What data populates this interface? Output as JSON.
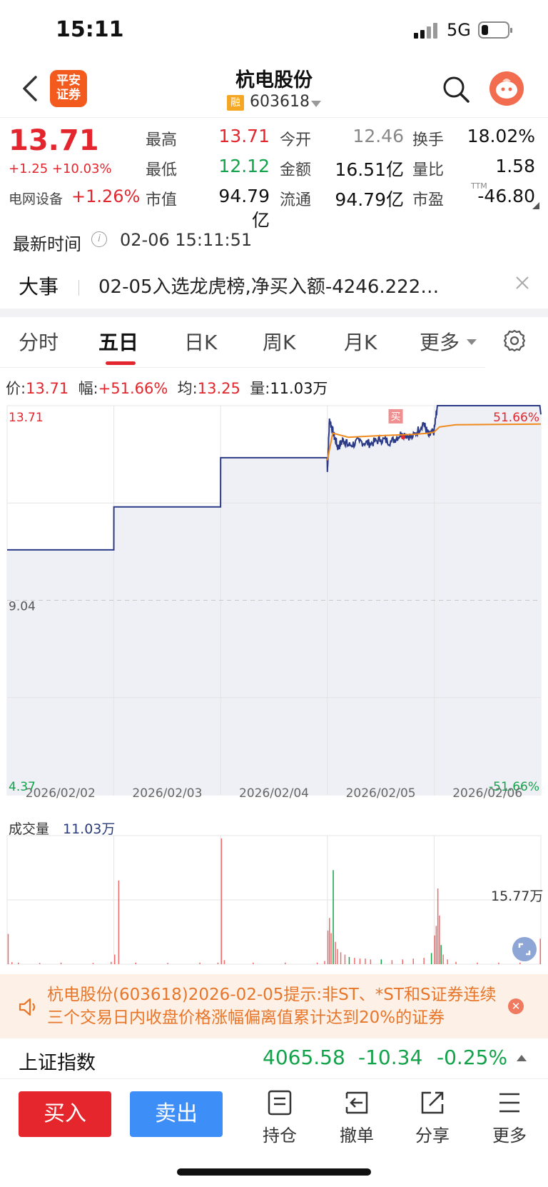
{
  "status": {
    "time": "15:11",
    "network": "5G"
  },
  "header": {
    "logo_line1": "平安",
    "logo_line2": "证券",
    "title": "杭电股份",
    "tag": "融",
    "code": "603618"
  },
  "quote": {
    "price": "13.71",
    "change": "+1.25  +10.03%",
    "sector_name": "电网设备",
    "sector_change": "+1.26%",
    "rows": [
      [
        {
          "l": "最高",
          "v": "13.71",
          "c": "red"
        },
        {
          "l": "今开",
          "v": "12.46",
          "c": "grey"
        },
        {
          "l": "换手",
          "v": "18.02%",
          "c": "blk"
        }
      ],
      [
        {
          "l": "最低",
          "v": "12.12",
          "c": "green"
        },
        {
          "l": "金额",
          "v": "16.51亿",
          "c": "blk"
        },
        {
          "l": "量比",
          "v": "1.58",
          "c": "blk"
        }
      ],
      [
        {
          "l": "市值",
          "v": "94.79亿",
          "c": "blk"
        },
        {
          "l": "流通",
          "v": "94.79亿",
          "c": "blk"
        },
        {
          "l": "市盈",
          "v": "-46.80",
          "c": "blk"
        }
      ]
    ],
    "ttm": "TTM"
  },
  "latest": {
    "label": "最新时间",
    "value": "02-06 15:11:51"
  },
  "event": {
    "label": "大事",
    "text": "02-05入选龙虎榜,净买入额-4246.222…"
  },
  "tabs": [
    "分时",
    "五日",
    "日K",
    "周K",
    "月K",
    "更多"
  ],
  "active_tab": "五日",
  "stats": {
    "price_label": "价:",
    "price": "13.71",
    "range_label": "幅:",
    "range": "+51.66%",
    "avg_label": "均:",
    "avg": "13.25",
    "vol_label": "量:",
    "vol": "11.03万"
  },
  "chart_data": {
    "type": "line",
    "ylim": [
      4.37,
      13.71
    ],
    "y_top_label": "13.71",
    "y_mid_label": "9.04",
    "y_bottom_label": "4.37",
    "pct_top": "51.66%",
    "pct_bottom": "-51.66%",
    "x_labels": [
      "2026/02/02",
      "2026/02/03",
      "2026/02/04",
      "2026/02/05",
      "2026/02/06"
    ],
    "buy_marker": "买",
    "series": [
      {
        "values": [
          [
            0.0,
            10.25
          ],
          [
            0.999,
            10.25
          ],
          [
            1.0,
            11.28
          ],
          [
            1.999,
            11.28
          ],
          [
            2.0,
            12.46
          ],
          [
            2.998,
            12.46
          ],
          [
            3.0,
            12.12
          ],
          [
            3.02,
            13.4
          ],
          [
            3.06,
            13.0
          ],
          [
            3.1,
            12.7
          ],
          [
            3.15,
            12.9
          ],
          [
            3.2,
            12.75
          ],
          [
            3.3,
            12.85
          ],
          [
            3.4,
            12.8
          ],
          [
            3.5,
            12.9
          ],
          [
            3.6,
            12.85
          ],
          [
            3.7,
            13.05
          ],
          [
            3.8,
            12.95
          ],
          [
            3.9,
            13.3
          ],
          [
            3.95,
            12.98
          ],
          [
            4.0,
            13.1
          ],
          [
            4.03,
            13.71
          ],
          [
            4.99,
            13.71
          ],
          [
            5.0,
            13.5
          ]
        ]
      },
      {
        "values": [
          [
            3.0,
            12.4
          ],
          [
            3.05,
            13.05
          ],
          [
            3.2,
            12.95
          ],
          [
            3.4,
            12.98
          ],
          [
            3.6,
            13.0
          ],
          [
            3.8,
            13.02
          ],
          [
            3.95,
            13.05
          ],
          [
            4.0,
            13.08
          ],
          [
            4.05,
            13.2
          ],
          [
            4.2,
            13.25
          ],
          [
            4.6,
            13.26
          ],
          [
            5.0,
            13.27
          ]
        ]
      }
    ]
  },
  "volume": {
    "title": "成交量",
    "value": "11.03万",
    "max_label": "15.77万",
    "max": 15.77,
    "bars": [
      [
        0.005,
        3.8
      ],
      [
        0.04,
        0.25
      ],
      [
        0.1,
        0.2
      ],
      [
        0.3,
        0.15
      ],
      [
        0.5,
        0.2
      ],
      [
        0.8,
        0.15
      ],
      [
        0.97,
        0.3
      ],
      [
        1.003,
        1.2
      ],
      [
        1.04,
        10.5
      ],
      [
        1.2,
        0.2
      ],
      [
        1.5,
        0.15
      ],
      [
        1.8,
        0.2
      ],
      [
        1.97,
        0.2
      ],
      [
        2.003,
        15.77
      ],
      [
        2.03,
        0.5
      ],
      [
        2.3,
        0.2
      ],
      [
        2.6,
        0.2
      ],
      [
        2.9,
        0.2
      ],
      [
        2.97,
        0.4
      ],
      [
        3.0,
        4.2
      ],
      [
        3.015,
        5.8
      ],
      [
        3.03,
        3.9
      ],
      [
        3.05,
        11.8
      ],
      [
        3.07,
        2.8
      ],
      [
        3.09,
        1.9
      ],
      [
        3.12,
        1.5
      ],
      [
        3.16,
        1.2
      ],
      [
        3.2,
        0.9
      ],
      [
        3.25,
        0.8
      ],
      [
        3.3,
        0.7
      ],
      [
        3.35,
        0.7
      ],
      [
        3.4,
        0.6
      ],
      [
        3.5,
        0.6
      ],
      [
        3.6,
        0.5
      ],
      [
        3.7,
        0.6
      ],
      [
        3.8,
        0.7
      ],
      [
        3.9,
        0.8
      ],
      [
        3.97,
        1.4
      ],
      [
        4.0,
        3.6
      ],
      [
        4.015,
        4.8
      ],
      [
        4.03,
        9.5
      ],
      [
        4.045,
        6.1
      ],
      [
        4.06,
        2.4
      ],
      [
        4.08,
        1.2
      ],
      [
        4.12,
        0.6
      ],
      [
        4.2,
        0.3
      ],
      [
        4.4,
        0.2
      ],
      [
        4.6,
        0.2
      ],
      [
        4.8,
        0.2
      ],
      [
        4.99,
        3.2
      ]
    ]
  },
  "notice": {
    "text": "杭电股份(603618)2026-02-05提示:非ST、*ST和S证券连续三个交易日内收盘价格涨幅偏离值累计达到20%的证券"
  },
  "index": {
    "name": "上证指数",
    "value": "4065.58",
    "change": "-10.34",
    "pct": "-0.25%"
  },
  "bottom": {
    "buy": "买入",
    "sell": "卖出",
    "items": [
      "持仓",
      "撤单",
      "分享",
      "更多"
    ]
  },
  "colors": {
    "up": "#e3262d",
    "down": "#12a34a",
    "price_line": "#2b3a86",
    "avg_line": "#f08a1c",
    "fill": "#eff0f6"
  }
}
